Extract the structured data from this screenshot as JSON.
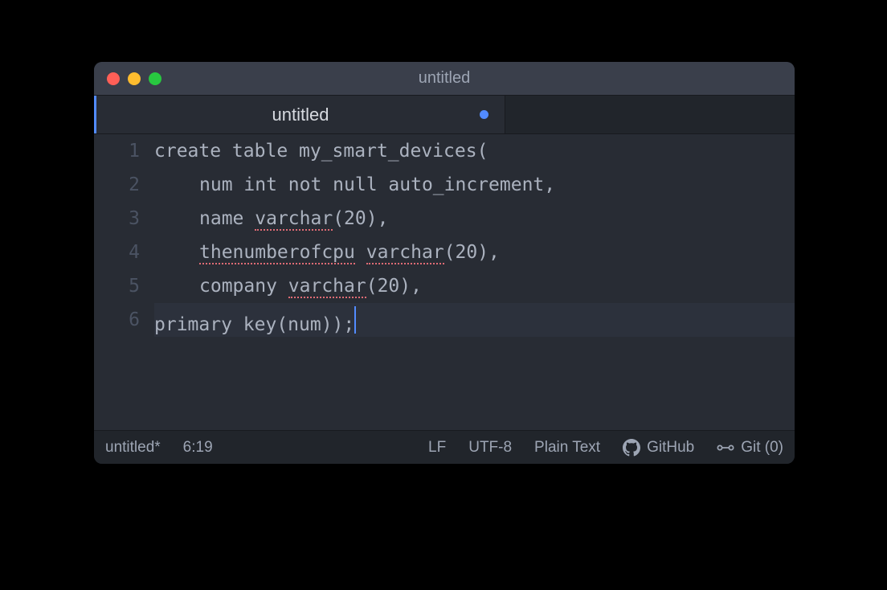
{
  "window": {
    "title": "untitled"
  },
  "tab": {
    "label": "untitled",
    "dirty": true
  },
  "editor": {
    "lineNumbers": [
      "1",
      "2",
      "3",
      "4",
      "5",
      "6"
    ],
    "cursorLine": 6,
    "lines": {
      "l1": "create table my_smart_devices(",
      "l2_a": "num int not null auto_increment,",
      "l3_a": "name ",
      "l3_sq": "varchar",
      "l3_c": "(20),",
      "l4_sq1": "thenumberofcpu",
      "l4_mid": " ",
      "l4_sq2": "varchar",
      "l4_c": "(20),",
      "l5_a": "company ",
      "l5_sq": "varchar",
      "l5_c": "(20),",
      "l6": "primary key(num));"
    }
  },
  "statusbar": {
    "filename": "untitled*",
    "position": "6:19",
    "eol": "LF",
    "encoding": "UTF-8",
    "grammar": "Plain Text",
    "github": "GitHub",
    "git": "Git (0)"
  }
}
